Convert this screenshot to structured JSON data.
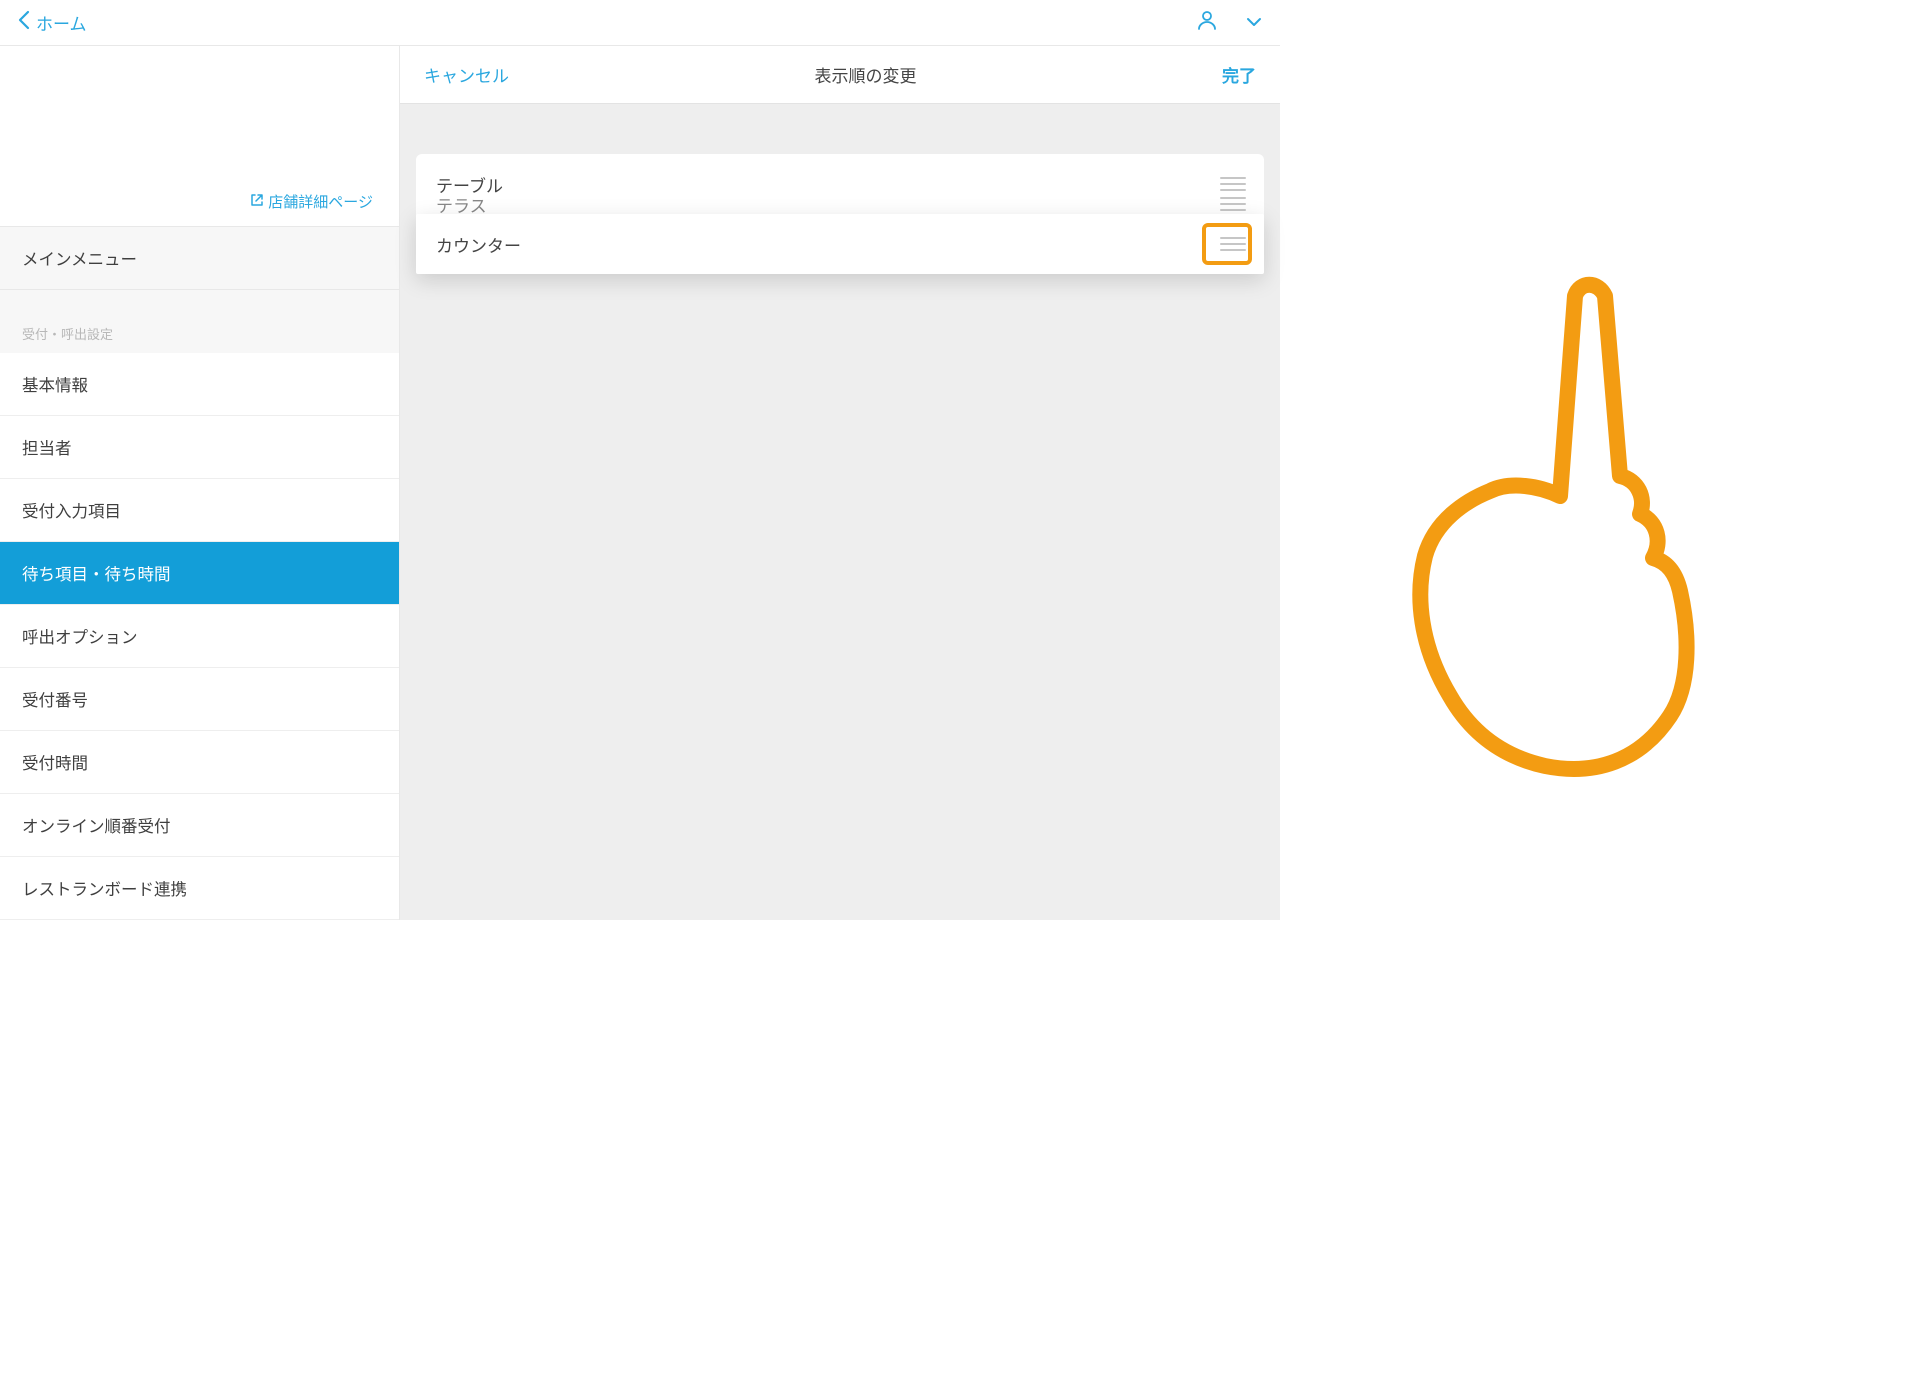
{
  "topbar": {
    "back_label": "ホーム"
  },
  "sidebar": {
    "store_link": "店舗詳細ページ",
    "main_menu": "メインメニュー",
    "section_label": "受付・呼出設定",
    "items": [
      "基本情報",
      "担当者",
      "受付入力項目",
      "待ち項目・待ち時間",
      "呼出オプション",
      "受付番号",
      "受付時間",
      "オンライン順番受付",
      "レストランボード連携"
    ]
  },
  "detail": {
    "cancel": "キャンセル",
    "title": "表示順の変更",
    "done": "完了",
    "rows": [
      "テーブル",
      "カウンター",
      "テラス"
    ]
  }
}
